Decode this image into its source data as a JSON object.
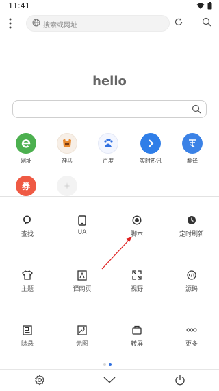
{
  "status_bar": {
    "time": "11:41"
  },
  "toolbar": {
    "search_placeholder": "搜索或网址"
  },
  "home": {
    "greeting": "hello"
  },
  "shortcuts": [
    {
      "label": "网址",
      "color": "#4cb04f",
      "icon": "e-icon"
    },
    {
      "label": "神马",
      "color": "#f6f0ea",
      "icon": "shenma-icon"
    },
    {
      "label": "百度",
      "color": "#f3f6ff",
      "icon": "baidu-icon"
    },
    {
      "label": "实时热讯",
      "color": "#2f7ee8",
      "icon": "arrow-icon"
    },
    {
      "label": "翻译",
      "color": "#3b82e6",
      "icon": "translate-icon"
    },
    {
      "label": "",
      "color": "#ef5a44",
      "icon": "coupon-icon",
      "glyph": "券"
    },
    {
      "label": "",
      "color": "#f1f1f1",
      "icon": "plane-icon"
    }
  ],
  "menu": [
    {
      "label": "查找",
      "icon": "find-icon"
    },
    {
      "label": "UA",
      "icon": "phone-icon"
    },
    {
      "label": "脚本",
      "icon": "script-icon"
    },
    {
      "label": "定时刷新",
      "icon": "clock-icon"
    },
    {
      "label": "主题",
      "icon": "shirt-icon"
    },
    {
      "label": "译网页",
      "icon": "translate-page-icon"
    },
    {
      "label": "视野",
      "icon": "expand-icon"
    },
    {
      "label": "源码",
      "icon": "code-icon"
    },
    {
      "label": "除悬",
      "icon": "remove-float-icon"
    },
    {
      "label": "无图",
      "icon": "no-image-icon"
    },
    {
      "label": "转屏",
      "icon": "rotate-icon"
    },
    {
      "label": "更多",
      "icon": "more-icon"
    }
  ],
  "colors": {
    "accent": "#2f6fe0",
    "annotation": "#e02020"
  }
}
